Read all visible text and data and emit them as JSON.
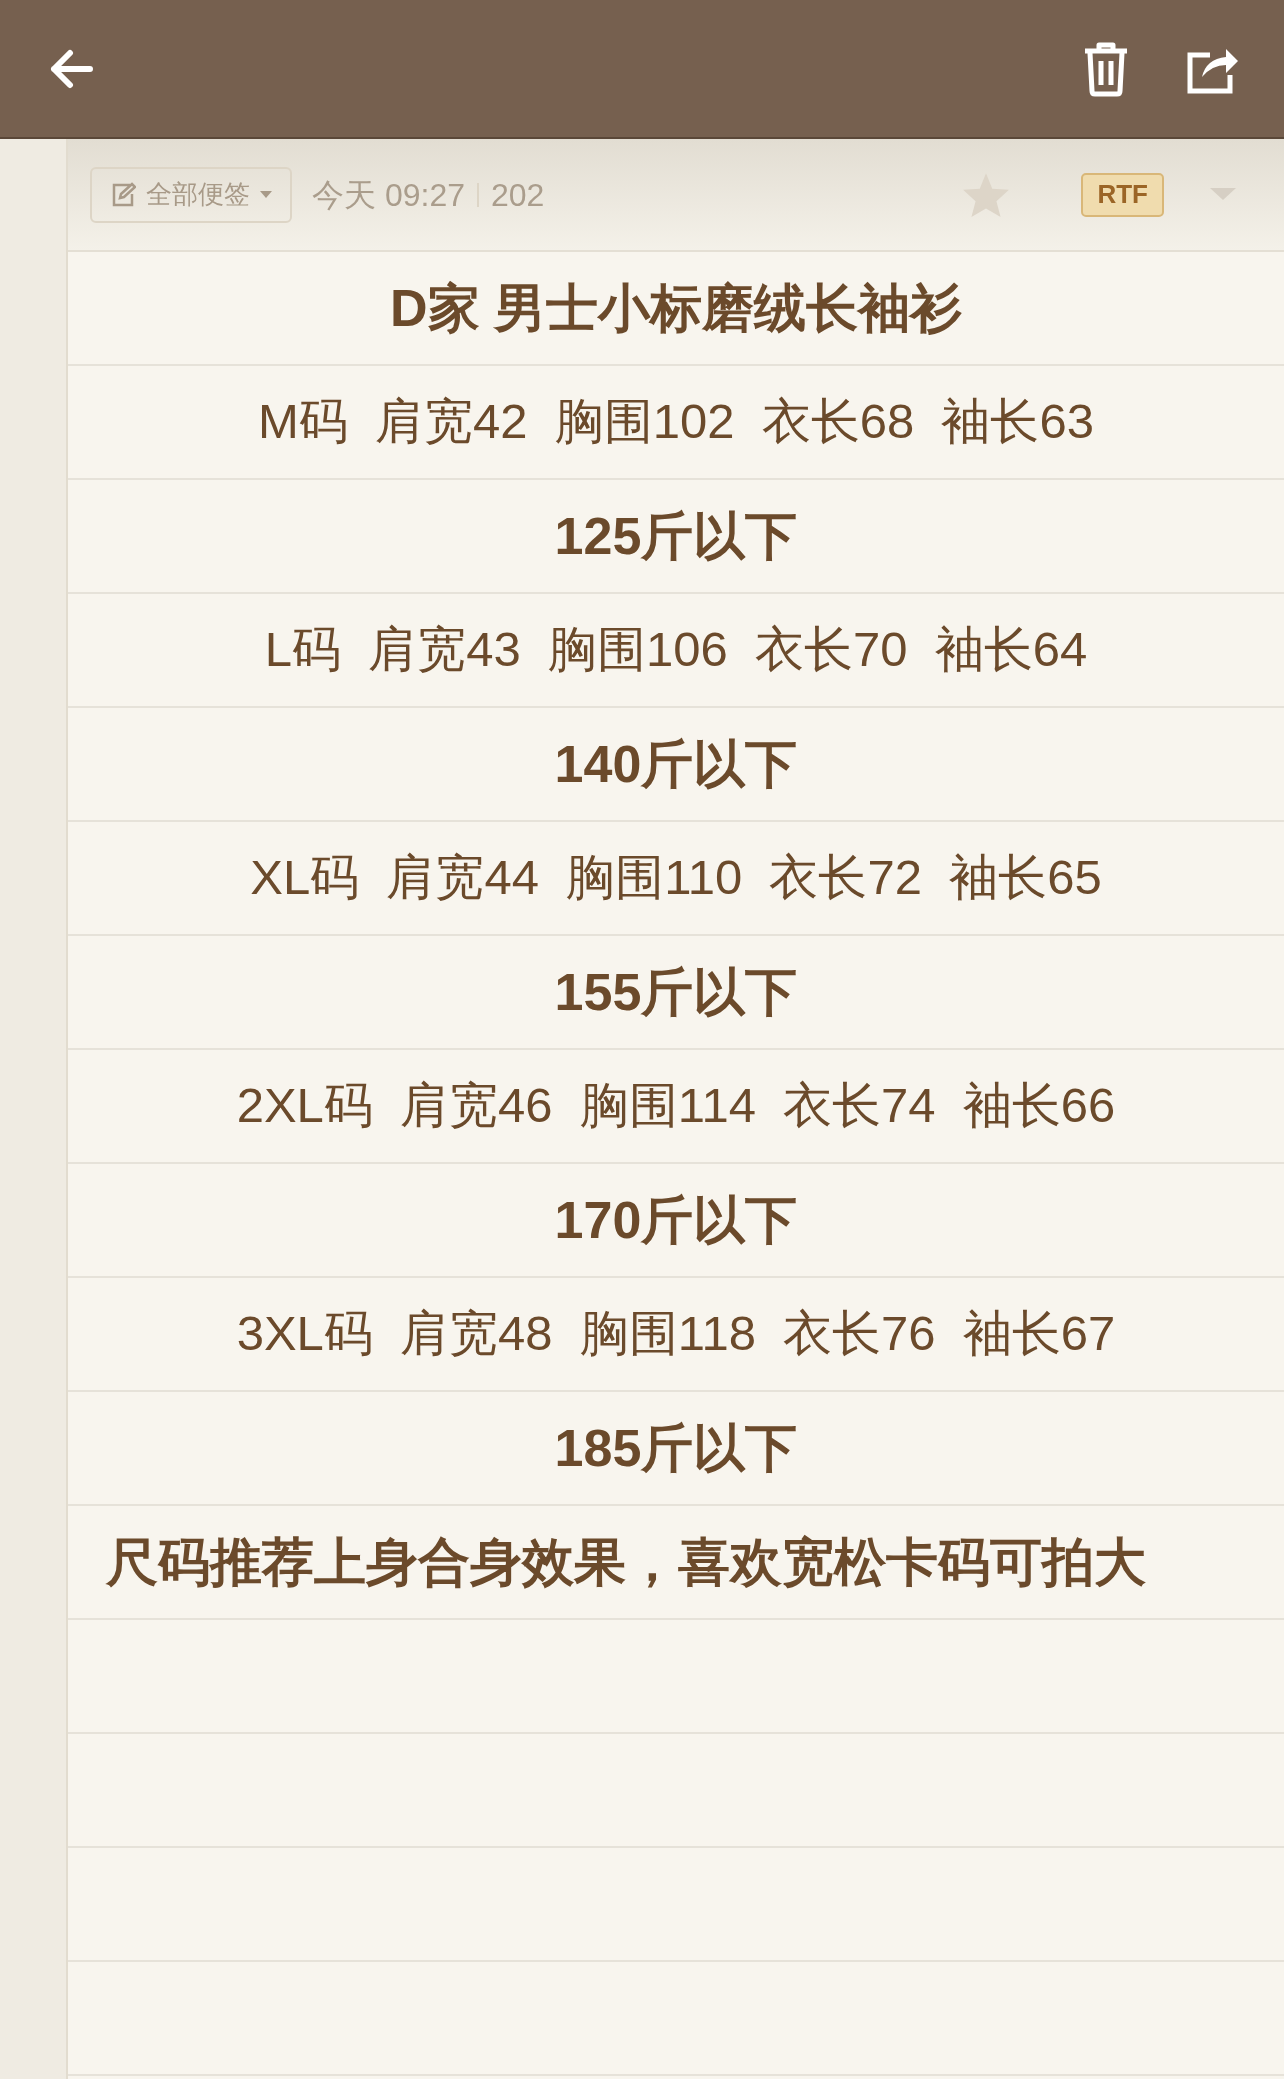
{
  "toolbar": {
    "buttons": [
      {
        "kind": "back"
      },
      {
        "kind": "delete"
      },
      {
        "kind": "share"
      }
    ]
  },
  "note_info": {
    "folder": "全部便签",
    "date": "今天 09:27",
    "count": "202",
    "starred": false,
    "format": "RTF"
  },
  "lines": [
    {
      "kind": "title",
      "text": "D家 男士小标磨绒长袖衫"
    },
    {
      "kind": "normal",
      "text": "M码  肩宽42  胸围102  衣长68  袖长63"
    },
    {
      "kind": "bold",
      "text": "125斤以下"
    },
    {
      "kind": "normal",
      "text": "L码  肩宽43  胸围106  衣长70  袖长64"
    },
    {
      "kind": "bold",
      "text": "140斤以下"
    },
    {
      "kind": "normal",
      "text": "XL码  肩宽44  胸围110  衣长72  袖长65"
    },
    {
      "kind": "bold",
      "text": "155斤以下"
    },
    {
      "kind": "normal",
      "text": "2XL码  肩宽46  胸围114  衣长74  袖长66"
    },
    {
      "kind": "bold",
      "text": "170斤以下"
    },
    {
      "kind": "normal",
      "text": "3XL码  肩宽48  胸围118  衣长76  袖长67"
    },
    {
      "kind": "bold",
      "text": "185斤以下"
    },
    {
      "kind": "note",
      "text": "尺码推荐上身合身效果，喜欢宽松卡码可拍大"
    }
  ]
}
